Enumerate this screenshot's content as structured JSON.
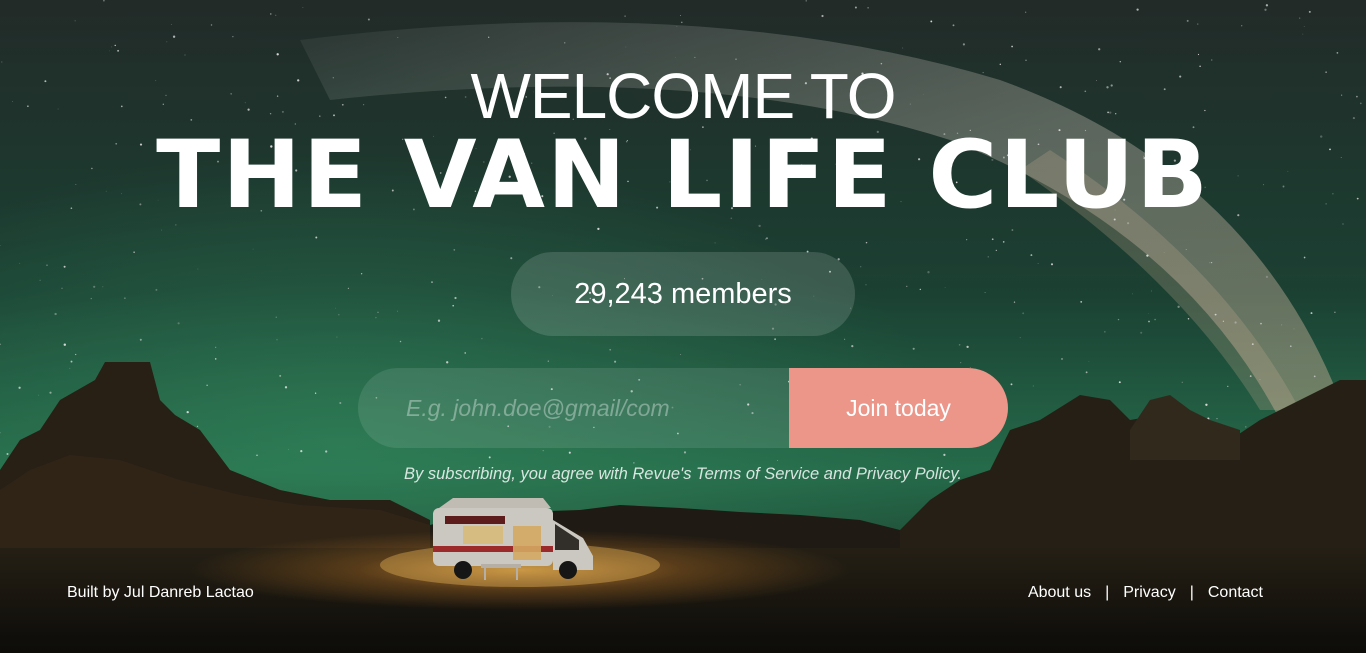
{
  "hero": {
    "welcome": "WELCOME TO",
    "club_name": "THE VAN LIFE CLUB"
  },
  "members": {
    "label": "29,243 members"
  },
  "signup": {
    "email_placeholder": "E.g. john.doe@gmail/com",
    "email_value": "",
    "join_label": "Join today",
    "terms": "By subscribing, you agree with Revue's Terms of Service and Privacy Policy."
  },
  "footer": {
    "credit": "Built by Jul Danreb Lactao",
    "links": [
      "About us",
      "Privacy",
      "Contact"
    ],
    "separator": "|"
  },
  "colors": {
    "accent": "#ec9589",
    "sky_top": "#2a3a34",
    "sky_glow": "#2f8a5e",
    "ground": "#1a1610",
    "lantern": "#f2a23a"
  },
  "background": {
    "icon": "night-sky-desert-campervan-image"
  }
}
